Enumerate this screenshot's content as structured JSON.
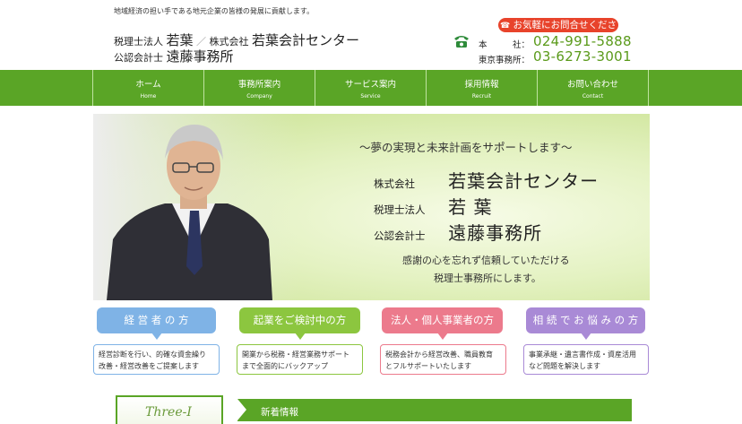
{
  "header": {
    "tagline": "地域経済の担い手である地元企業の皆様の発展に貢献します。",
    "firm_line1_a": "税理士法人",
    "firm_line1_b": "若葉",
    "firm_line1_sep": "／",
    "firm_line1_c": "株式会社",
    "firm_line1_d": "若葉会計センター",
    "firm_line2_a": "公認会計士",
    "firm_line2_b": "遠藤事務所",
    "contact_button": "お気軽にお問合せください",
    "tel_label_1": "本　　　社：",
    "tel_1": "024-991-5888",
    "tel_label_2": "東京事務所：",
    "tel_2": "03-6273-3001",
    "phone_icon": "phone-icon"
  },
  "nav": [
    {
      "jp": "ホーム",
      "en": "Home"
    },
    {
      "jp": "事務所案内",
      "en": "Company"
    },
    {
      "jp": "サービス案内",
      "en": "Service"
    },
    {
      "jp": "採用情報",
      "en": "Recruit"
    },
    {
      "jp": "お問い合わせ",
      "en": "Contact"
    }
  ],
  "hero": {
    "tagline": "～夢の実現と未来計画をサポートします～",
    "row1_small": "株式会社",
    "row1_big": "若葉会計センター",
    "row2_small": "税理士法人",
    "row2_big": "若 葉",
    "row3_small": "公認会計士",
    "row3_big": "遠藤事務所",
    "line1": "感謝の心を忘れず信頼していただける",
    "line2": "税理士事務所にします。"
  },
  "cards": [
    {
      "title": "経 営 者 の 方",
      "body1": "経営診断を行い、的確な資金繰り",
      "body2": "改善・経営改善をご提案します",
      "color": "#7fb3e6"
    },
    {
      "title": "起業をご検討中の方",
      "body1": "開業から税務・経営業務サポート",
      "body2": "まで全面的にバックアップ",
      "color": "#8cc63f"
    },
    {
      "title": "法人・個人事業者の方",
      "body1": "税務会計から経営改善、職員教育",
      "body2": "とフルサポートいたします",
      "color": "#ec7a8c"
    },
    {
      "title": "相 続 で お 悩 み の 方",
      "body1": "事業承継・遺言書作成・資産活用",
      "body2": "など問題を解決します",
      "color": "#a98ad6"
    }
  ],
  "bottom": {
    "logo_text": "Three-I",
    "news_title": "新着情報"
  },
  "colors": {
    "brand_green": "#5aa526",
    "accent_red": "#e8432b"
  }
}
